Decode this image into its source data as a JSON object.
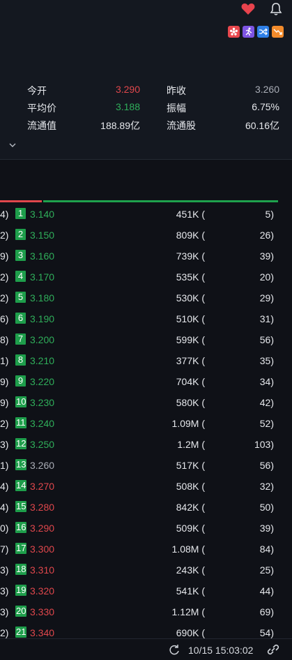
{
  "header": {
    "icons": [
      "heart-icon",
      "bell-icon"
    ],
    "feature_icons": [
      "hk-flower-icon",
      "runner-icon",
      "shuffle-icon",
      "trend-down-icon"
    ],
    "colors": {
      "up": "#e0474c",
      "down": "#2fae5a",
      "neutral": "#a9adb6",
      "level_badge": "#1e9e4b"
    }
  },
  "stats": [
    {
      "label1": "今开",
      "value1": "3.290",
      "color1": "red",
      "label2": "昨收",
      "value2": "3.260",
      "color2": "grey"
    },
    {
      "label1": "平均价",
      "value1": "3.188",
      "color1": "green",
      "label2": "振幅",
      "value2": "6.75%",
      "color2": ""
    },
    {
      "label1": "流通值",
      "value1": "188.89亿",
      "color1": "",
      "label2": "流通股",
      "value2": "60.16亿",
      "color2": ""
    }
  ],
  "order_book": [
    {
      "left": "4)",
      "level": "1",
      "price": "3.140",
      "color": "green",
      "volume": "451K (",
      "count": "5)"
    },
    {
      "left": "2)",
      "level": "2",
      "price": "3.150",
      "color": "green",
      "volume": "809K (",
      "count": "26)"
    },
    {
      "left": "9)",
      "level": "3",
      "price": "3.160",
      "color": "green",
      "volume": "739K (",
      "count": "39)"
    },
    {
      "left": "2)",
      "level": "4",
      "price": "3.170",
      "color": "green",
      "volume": "535K (",
      "count": "20)"
    },
    {
      "left": "2)",
      "level": "5",
      "price": "3.180",
      "color": "green",
      "volume": "530K (",
      "count": "29)"
    },
    {
      "left": "6)",
      "level": "6",
      "price": "3.190",
      "color": "green",
      "volume": "510K (",
      "count": "31)"
    },
    {
      "left": "8)",
      "level": "7",
      "price": "3.200",
      "color": "green",
      "volume": "599K (",
      "count": "56)"
    },
    {
      "left": "1)",
      "level": "8",
      "price": "3.210",
      "color": "green",
      "volume": "377K (",
      "count": "35)"
    },
    {
      "left": "9)",
      "level": "9",
      "price": "3.220",
      "color": "green",
      "volume": "704K (",
      "count": "34)"
    },
    {
      "left": "9)",
      "level": "10",
      "price": "3.230",
      "color": "green",
      "volume": "580K (",
      "count": "42)"
    },
    {
      "left": "2)",
      "level": "11",
      "price": "3.240",
      "color": "green",
      "volume": "1.09M (",
      "count": "52)"
    },
    {
      "left": "3)",
      "level": "12",
      "price": "3.250",
      "color": "green",
      "volume": "1.2M (",
      "count": "103)"
    },
    {
      "left": "1)",
      "level": "13",
      "price": "3.260",
      "color": "grey",
      "volume": "517K (",
      "count": "56)"
    },
    {
      "left": "4)",
      "level": "14",
      "price": "3.270",
      "color": "red",
      "volume": "508K (",
      "count": "32)"
    },
    {
      "left": "4)",
      "level": "15",
      "price": "3.280",
      "color": "red",
      "volume": "842K (",
      "count": "50)"
    },
    {
      "left": "0)",
      "level": "16",
      "price": "3.290",
      "color": "red",
      "volume": "509K (",
      "count": "39)"
    },
    {
      "left": "7)",
      "level": "17",
      "price": "3.300",
      "color": "red",
      "volume": "1.08M (",
      "count": "84)"
    },
    {
      "left": "3)",
      "level": "18",
      "price": "3.310",
      "color": "red",
      "volume": "243K (",
      "count": "25)"
    },
    {
      "left": "3)",
      "level": "19",
      "price": "3.320",
      "color": "red",
      "volume": "541K (",
      "count": "44)"
    },
    {
      "left": "3)",
      "level": "20",
      "price": "3.330",
      "color": "red",
      "volume": "1.12M (",
      "count": "69)"
    },
    {
      "left": "2)",
      "level": "21",
      "price": "3.340",
      "color": "red",
      "volume": "690K (",
      "count": "54)"
    }
  ],
  "ratio": {
    "sell_fraction": 0.15
  },
  "footer": {
    "timestamp": "10/15 15:03:02"
  }
}
